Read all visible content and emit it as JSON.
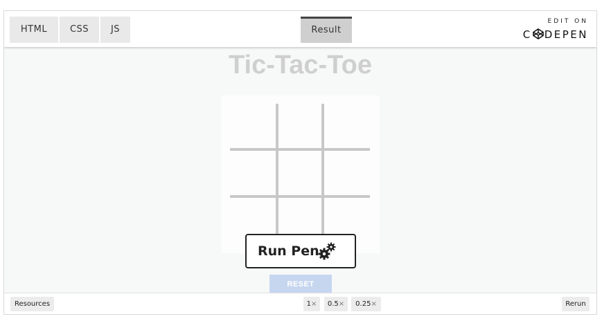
{
  "tabs": {
    "html": "HTML",
    "css": "CSS",
    "js": "JS",
    "result": "Result"
  },
  "logo": {
    "edit_on": "EDIT ON",
    "brand_left": "C",
    "brand_right": "DEPEN"
  },
  "game": {
    "title": "Tic-Tac-Toe",
    "reset_label": "RESET"
  },
  "run_pen": {
    "label": "Run Pen",
    "icon": "gears-icon"
  },
  "bottom": {
    "resources": "Resources",
    "zoom_options": [
      {
        "value": "1",
        "suffix": "×"
      },
      {
        "value": "0.5",
        "suffix": "×"
      },
      {
        "value": "0.25",
        "suffix": "×"
      }
    ],
    "rerun": "Rerun"
  },
  "colors": {
    "title": "#cfcfcf",
    "grid_lines": "#c8c8c8",
    "reset_button": "#c7d6ef",
    "active_tab": "#cfcfcf"
  }
}
